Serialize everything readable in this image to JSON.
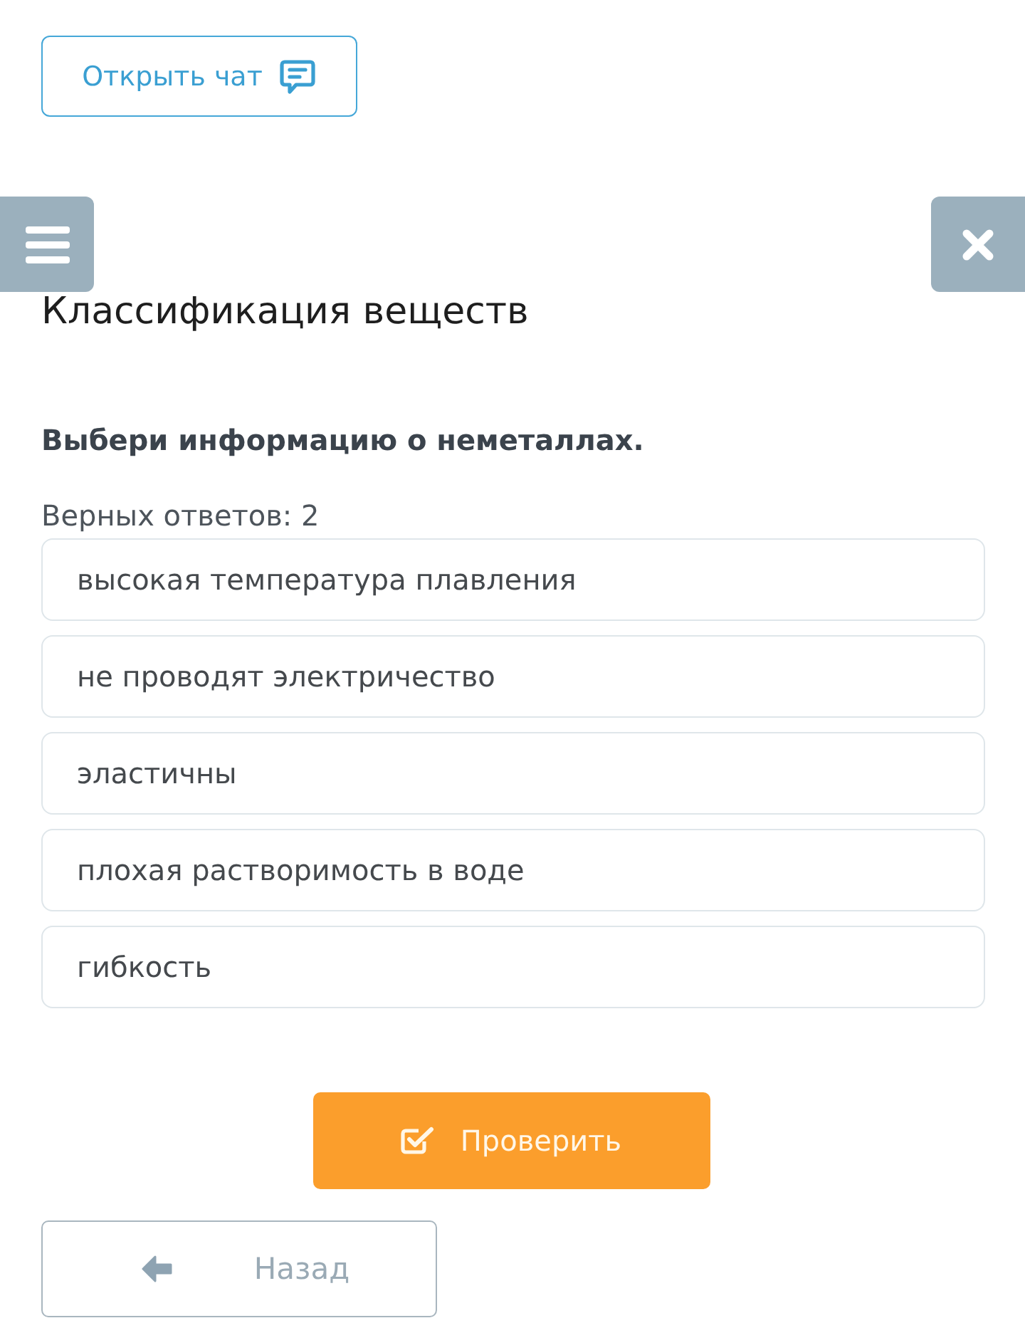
{
  "chat_button": {
    "label": "Открыть чат"
  },
  "title": "Классификация веществ",
  "question": "Выбери информацию о неметаллах.",
  "answers_hint": "Верных ответов: 2",
  "options": [
    {
      "label": "высокая температура плавления",
      "selected": false
    },
    {
      "label": "не проводят электричество",
      "selected": false
    },
    {
      "label": "эластичны",
      "selected": false
    },
    {
      "label": "плохая растворимость в воде",
      "selected": false
    },
    {
      "label": "гибкость",
      "selected": false
    }
  ],
  "check_button": {
    "label": "Проверить"
  },
  "back_button": {
    "label": "Назад"
  }
}
